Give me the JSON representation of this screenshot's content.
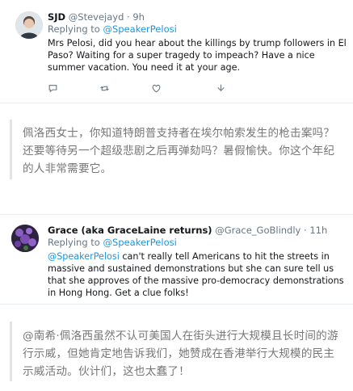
{
  "tweet1": {
    "name": "SJD",
    "handle": "@Stevejayd",
    "separator": "·",
    "time": "9h",
    "replying_prefix": "Replying to",
    "replying_to": "@SpeakerPelosi",
    "text": "Mrs Pelosi, did you hear about the killings by trump followers in El Paso? Waiting for a super tragedy to impeach? Have a nice summer vacation. You need it at your age.",
    "reply_count": "",
    "retweet_count": "",
    "like_count": ""
  },
  "caption1": "佩洛西女士，你知道特朗普支持者在埃尔帕索发生的枪击案吗？还要等待另一个超级悲剧之后再弹劾吗？暑假愉快。你这个年纪的人非常需要它。",
  "tweet2": {
    "name": "Grace (aka GraceLaine returns)",
    "handle": "@Grace_GoBlindly",
    "separator": "·",
    "time": "11h",
    "replying_prefix": "Replying to",
    "replying_to": "@SpeakerPelosi",
    "mention": "@SpeakerPelosi",
    "text": " can't really tell Americans to hit the streets in massive and sustained demonstrations but she can sure tell us that she approves of the massive pro-democracy demonstrations in Hong Hong. Get a clue folks!"
  },
  "caption2": "@南希·佩洛西虽然不认可美国人在街头进行大规模且长时间的游行示威，但她肯定地告诉我们，她赞成在香港举行大规模的民主示威活动。伙计们，这也太蠢了！",
  "colors": {
    "link": "#1b95e0",
    "muted": "#657786",
    "caption": "#777777"
  },
  "icons": [
    "reply-icon",
    "retweet-icon",
    "like-icon",
    "more-icon"
  ]
}
